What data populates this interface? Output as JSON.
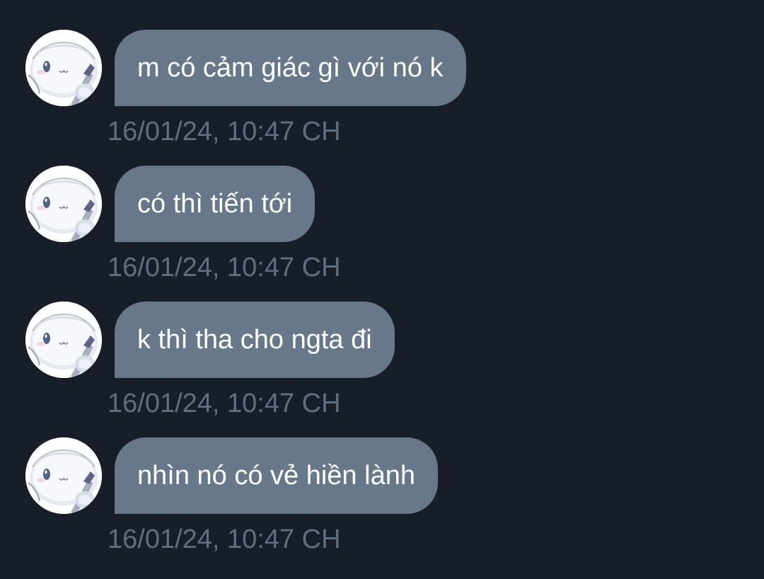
{
  "thread": {
    "messages": [
      {
        "text": "m có cảm giác gì với nó k",
        "timestamp": "16/01/24, 10:47 CH"
      },
      {
        "text": "có thì tiến tới",
        "timestamp": "16/01/24, 10:47 CH"
      },
      {
        "text": "k thì tha cho ngta đi",
        "timestamp": "16/01/24, 10:47 CH"
      },
      {
        "text": "nhìn nó có vẻ hiền lành",
        "timestamp": "16/01/24, 10:47 CH"
      }
    ]
  },
  "colors": {
    "background": "#171e28",
    "bubble": "#66788a",
    "bubble_text": "#ffffff",
    "timestamp": "#5f6e80"
  },
  "icons": {
    "avatar": "avatar-icon"
  }
}
